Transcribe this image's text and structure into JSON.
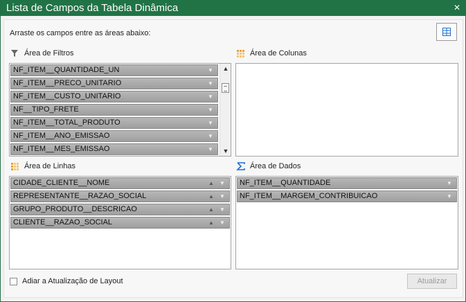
{
  "window": {
    "title": "Lista de Campos da Tabela Dinâmica",
    "close_glyph": "✕"
  },
  "instruction": "Arraste os campos entre as áreas abaixo:",
  "areas": {
    "filters": {
      "label": "Área de Filtros",
      "icon": "filter-icon",
      "fields": [
        "NF_ITEM__QUANTIDADE_UN",
        "NF_ITEM__PRECO_UNITARIO",
        "NF_ITEM__CUSTO_UNITARIO",
        "NF__TIPO_FRETE",
        "NF_ITEM__TOTAL_PRODUTO",
        "NF_ITEM__ANO_EMISSAO",
        "NF_ITEM__MES_EMISSAO"
      ]
    },
    "columns": {
      "label": "Área de Colunas",
      "icon": "columns-grid-icon",
      "fields": []
    },
    "rows": {
      "label": "Área de Linhas",
      "icon": "rows-grid-icon",
      "fields": [
        "CIDADE_CLIENTE__NOME",
        "REPRESENTANTE__RAZAO_SOCIAL",
        "GRUPO_PRODUTO__DESCRICAO",
        "CLIENTE__RAZAO_SOCIAL"
      ]
    },
    "data": {
      "label": "Área de Dados",
      "icon": "sigma-icon",
      "fields": [
        "NF_ITEM__QUANTIDADE",
        "NF_ITEM__MARGEM_CONTRIBUICAO"
      ]
    }
  },
  "glyphs": {
    "dropdown": "▼",
    "sort_up": "▲",
    "scroll_up": "▲",
    "scroll_down": "▼"
  },
  "footer": {
    "defer_label": "Adiar a Atualização de Layout",
    "defer_checked": false,
    "update_label": "Atualizar"
  },
  "colors": {
    "titlebar": "#217346",
    "accent_orange": "#e8a33a",
    "accent_blue": "#1e6fd0"
  }
}
